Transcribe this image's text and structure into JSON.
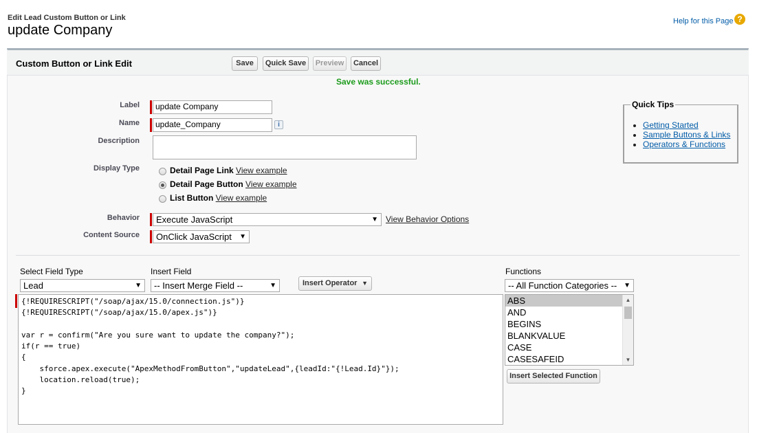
{
  "header": {
    "subtitle": "Edit Lead Custom Button or Link",
    "title": "update Company",
    "help_label": "Help for this Page",
    "help_icon": "question-icon"
  },
  "panel": {
    "title": "Custom Button or Link Edit",
    "buttons": {
      "save": "Save",
      "quick_save": "Quick Save",
      "preview": "Preview",
      "cancel": "Cancel"
    },
    "message": "Save was successful."
  },
  "form": {
    "label": {
      "caption": "Label",
      "value": "update Company"
    },
    "name": {
      "caption": "Name",
      "value": "update_Company"
    },
    "description": {
      "caption": "Description",
      "value": ""
    },
    "display_type": {
      "caption": "Display Type",
      "options": [
        {
          "label": "Detail Page Link",
          "link": "View example",
          "checked": false
        },
        {
          "label": "Detail Page Button",
          "link": "View example",
          "checked": true
        },
        {
          "label": "List Button",
          "link": "View example",
          "checked": false
        }
      ]
    },
    "behavior": {
      "caption": "Behavior",
      "value": "Execute JavaScript",
      "link": "View Behavior Options"
    },
    "content_source": {
      "caption": "Content Source",
      "value": "OnClick JavaScript"
    }
  },
  "quick_tips": {
    "title": "Quick Tips",
    "links": [
      "Getting Started",
      "Sample Buttons & Links",
      "Operators & Functions"
    ]
  },
  "editor": {
    "select_field_type": {
      "caption": "Select Field Type",
      "value": "Lead"
    },
    "insert_field": {
      "caption": "Insert Field",
      "value": "-- Insert Merge Field --"
    },
    "insert_operator": "Insert Operator",
    "code": "{!REQUIRESCRIPT(\"/soap/ajax/15.0/connection.js\")}\n{!REQUIRESCRIPT(\"/soap/ajax/15.0/apex.js\")}\n\nvar r = confirm(\"Are you sure want to update the company?\");\nif(r == true)\n{\n    sforce.apex.execute(\"ApexMethodFromButton\",\"updateLead\",{leadId:\"{!Lead.Id}\"});\n    location.reload(true);\n}",
    "functions": {
      "caption": "Functions",
      "category": "-- All Function Categories --",
      "items": [
        "ABS",
        "AND",
        "BEGINS",
        "BLANKVALUE",
        "CASE",
        "CASESAFEID"
      ],
      "selected": "ABS",
      "insert_button": "Insert Selected Function"
    }
  }
}
